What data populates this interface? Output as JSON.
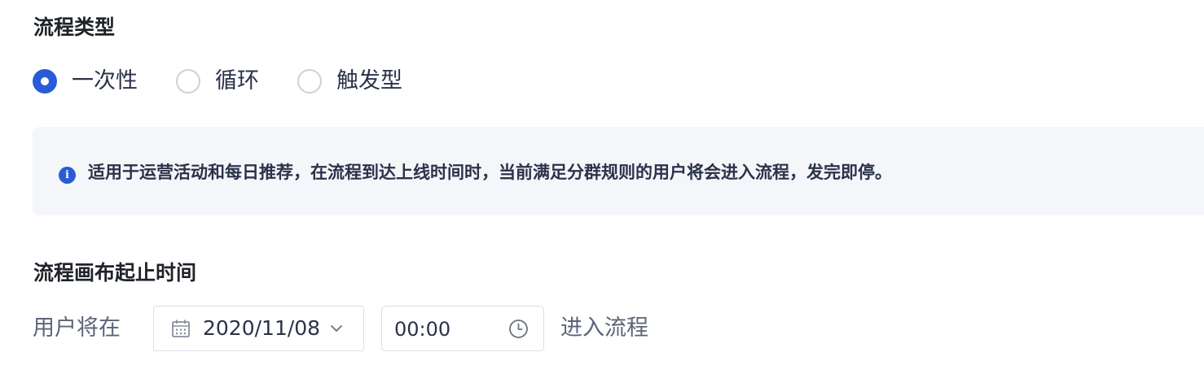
{
  "flow_type": {
    "title": "流程类型",
    "options": [
      {
        "label": "一次性",
        "checked": true
      },
      {
        "label": "循环",
        "checked": false
      },
      {
        "label": "触发型",
        "checked": false
      }
    ],
    "info_text": "适用于运营活动和每日推荐，在流程到达上线时间时，当前满足分群规则的用户将会进入流程，发完即停。",
    "info_icon_glyph": "i"
  },
  "canvas_range": {
    "title": "流程画布起止时间",
    "prefix": "用户将在",
    "date_value": "2020/11/08",
    "time_value": "00:00",
    "suffix": "进入流程"
  },
  "colors": {
    "accent": "#2a5bd7",
    "info_bg": "#f5f6fa",
    "border": "#dcdfe6"
  },
  "icons": {
    "radio": "radio-icon",
    "info": "info-icon",
    "calendar": "calendar-icon",
    "chevron": "chevron-down-icon",
    "clock": "clock-icon"
  }
}
